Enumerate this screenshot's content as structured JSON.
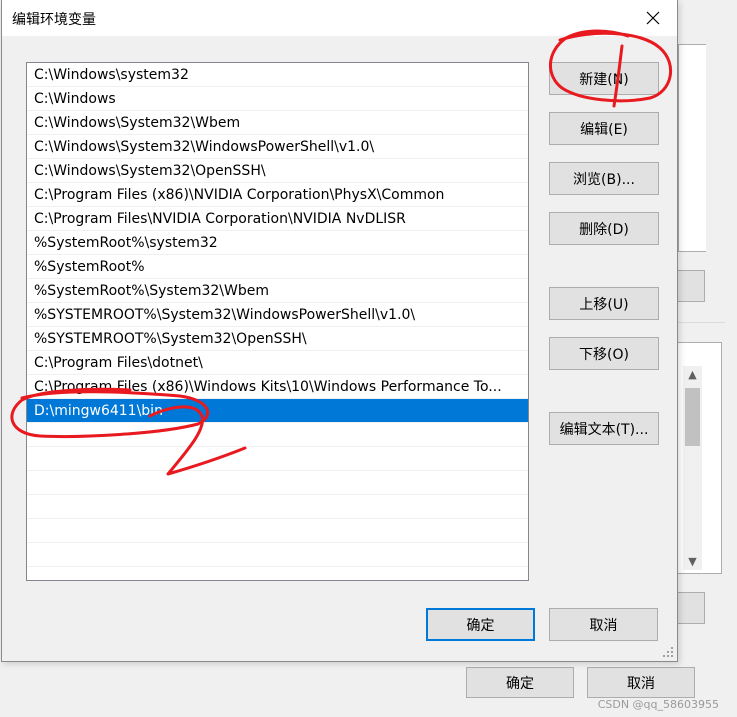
{
  "dialog": {
    "title": "编辑环境变量",
    "close_icon": "close-icon",
    "paths": [
      "C:\\Windows\\system32",
      "C:\\Windows",
      "C:\\Windows\\System32\\Wbem",
      "C:\\Windows\\System32\\WindowsPowerShell\\v1.0\\",
      "C:\\Windows\\System32\\OpenSSH\\",
      "C:\\Program Files (x86)\\NVIDIA Corporation\\PhysX\\Common",
      "C:\\Program Files\\NVIDIA Corporation\\NVIDIA NvDLISR",
      "%SystemRoot%\\system32",
      "%SystemRoot%",
      "%SystemRoot%\\System32\\Wbem",
      "%SYSTEMROOT%\\System32\\WindowsPowerShell\\v1.0\\",
      "%SYSTEMROOT%\\System32\\OpenSSH\\",
      "C:\\Program Files\\dotnet\\",
      "C:\\Program Files (x86)\\Windows Kits\\10\\Windows Performance To...",
      "D:\\mingw6411\\bin"
    ],
    "selected_path": "D:\\mingw6411\\bin",
    "buttons": {
      "new": "新建(N)",
      "edit": "编辑(E)",
      "browse": "浏览(B)...",
      "delete": "删除(D)",
      "move_up": "上移(U)",
      "move_down": "下移(O)",
      "edit_text": "编辑文本(T)..."
    },
    "ok": "确定",
    "cancel": "取消"
  },
  "parent_dialog": {
    "ok": "确定",
    "cancel": "取消"
  },
  "watermark": "CSDN @qq_58603955",
  "colors": {
    "selection": "#0078d7",
    "annotation": "#e8191f",
    "button_face": "#e1e1e1"
  }
}
